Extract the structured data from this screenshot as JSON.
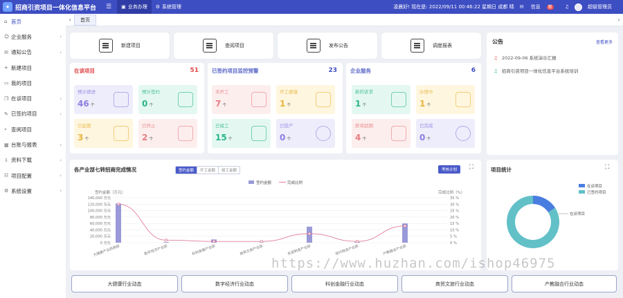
{
  "topbar": {
    "app_title": "招商引资项目一体化信息平台",
    "nav": [
      {
        "label": "业务办理",
        "icon": "briefcase-icon"
      },
      {
        "label": "系统管理",
        "icon": "gear-icon"
      }
    ],
    "greeting": "凌晨好! 现在是: 2022/09/11 00:46:22 星期日 成都 晴",
    "message_label": "信息",
    "message_badge": "新",
    "user_name": "超级管理员"
  },
  "sidebar": {
    "items": [
      {
        "label": "首页",
        "icon": "home-icon",
        "has_children": false
      },
      {
        "label": "企业服务",
        "icon": "service-icon",
        "has_children": true
      },
      {
        "label": "通知公告",
        "icon": "notice-icon",
        "has_children": true
      },
      {
        "label": "新建项目",
        "icon": "plus-icon",
        "has_children": false
      },
      {
        "label": "我的项目",
        "icon": "folder-icon",
        "has_children": false
      },
      {
        "label": "在谈项目",
        "icon": "chat-icon",
        "has_children": true
      },
      {
        "label": "已签约项目",
        "icon": "sign-icon",
        "has_children": true
      },
      {
        "label": "查阅项目",
        "icon": "search-icon",
        "has_children": false
      },
      {
        "label": "台账与报表",
        "icon": "table-icon",
        "has_children": true
      },
      {
        "label": "资料下载",
        "icon": "download-icon",
        "has_children": true
      },
      {
        "label": "项目配置",
        "icon": "config-icon",
        "has_children": true
      },
      {
        "label": "系统设置",
        "icon": "gear-icon",
        "has_children": true
      }
    ]
  },
  "tabs": {
    "active": "首页"
  },
  "quick_actions": [
    {
      "label": "新建项目"
    },
    {
      "label": "查阅项目"
    },
    {
      "label": "发布公告"
    },
    {
      "label": "调度报表"
    }
  ],
  "in_talk": {
    "title": "在谈项目",
    "count": "51",
    "tiles": [
      {
        "label": "预计跟进",
        "value": "46",
        "unit": "个"
      },
      {
        "label": "预计签约",
        "value": "0",
        "unit": "个"
      },
      {
        "label": "已延期",
        "value": "3",
        "unit": "个"
      },
      {
        "label": "已终止",
        "value": "2",
        "unit": "个"
      }
    ]
  },
  "signed": {
    "title": "已签约项目监控预警",
    "count": "23",
    "tiles": [
      {
        "label": "未开工",
        "value": "7",
        "unit": "个"
      },
      {
        "label": "开工缓慢",
        "value": "1",
        "unit": "个"
      },
      {
        "label": "已竣工",
        "value": "15",
        "unit": "个"
      },
      {
        "label": "已投产",
        "value": "0",
        "unit": "个"
      }
    ]
  },
  "enterprise": {
    "title": "企业服务",
    "count": "6",
    "tiles": [
      {
        "label": "新的诉求",
        "value": "1",
        "unit": "个"
      },
      {
        "label": "办理中",
        "value": "1",
        "unit": "个"
      },
      {
        "label": "即将超期",
        "value": "4",
        "unit": "个"
      },
      {
        "label": "已完成",
        "value": "0",
        "unit": "个"
      }
    ]
  },
  "notice": {
    "title": "公告",
    "more": "查看更多",
    "items": [
      {
        "text": "2022-09-06 系统演示汇报",
        "color": "#e0484b"
      },
      {
        "text": "招商引资项目一体化信息平台系统培训",
        "color": "#2db38a"
      }
    ]
  },
  "industry_chart": {
    "title": "各产业部七转招商完成情况",
    "segments": [
      "签约金额",
      "开工金额",
      "竣工金额"
    ],
    "compare_button": "考核计划",
    "legend": [
      "签约金额",
      "完成比例"
    ],
    "left_axis_title": "签约金额（万元）",
    "right_axis_title": "完成比例（%）"
  },
  "project_stats": {
    "title": "项目统计",
    "legend": [
      "在谈项目",
      "已签约项目"
    ],
    "slice_label": "在谈项目"
  },
  "bottom_buttons": [
    "大健康行业动态",
    "数字经济行业动态",
    "科创金融行业动态",
    "商贸文旅行业动态",
    "产教融合行业动态"
  ],
  "watermark": "https://www.huzhan.com/ishop46975",
  "chart_data": [
    {
      "type": "bar",
      "title": "各产业部七转招商完成情况",
      "categories": [
        "大健康产业招商部",
        "数字经济产业部",
        "科创金融产业部",
        "商贸文旅产业部",
        "先进制造产业部",
        "现代物流产业部",
        "产教融合产业部"
      ],
      "series": [
        {
          "name": "签约金额",
          "type": "bar",
          "axis": "left",
          "values": [
            122000,
            2000,
            10000,
            1000,
            50000,
            2000,
            60000
          ]
        },
        {
          "name": "完成比例",
          "type": "line",
          "axis": "right",
          "values": [
            30,
            2,
            1,
            1,
            7,
            1,
            13
          ]
        }
      ],
      "y_ticks": [
        "0 万元",
        "20,000 万元",
        "40,000 万元",
        "60,000 万元",
        "80,000 万元",
        "100,000 万元",
        "120,000 万元",
        "140,000 万元"
      ],
      "y2_ticks": [
        "0 %",
        "5 %",
        "10 %",
        "15 %",
        "20 %",
        "25 %",
        "30 %",
        "35 %"
      ],
      "ylim": [
        0,
        140000
      ],
      "y2lim": [
        0,
        35
      ],
      "bar_color": "#9a9ad8",
      "line_color": "#e07f98",
      "legend_position": "top-center"
    },
    {
      "type": "pie",
      "title": "项目统计",
      "categories": [
        "在谈项目",
        "已签约项目"
      ],
      "values": [
        16,
        84
      ],
      "colors": [
        "#4a7de0",
        "#62c0c7"
      ],
      "legend_position": "top-right"
    }
  ]
}
